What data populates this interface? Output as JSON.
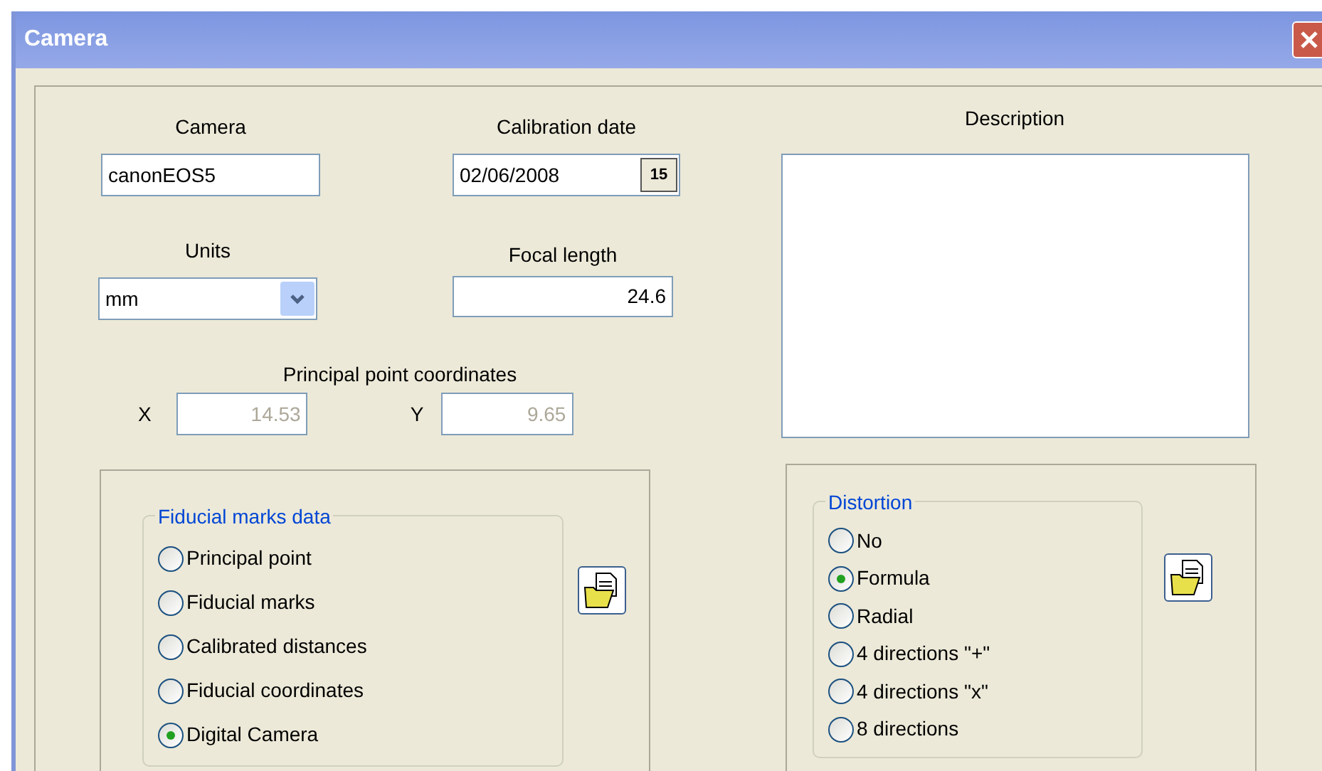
{
  "window": {
    "title": "Camera"
  },
  "camera": {
    "label": "Camera",
    "value": "canonEOS5"
  },
  "calibration_date": {
    "label": "Calibration date",
    "value": "02/06/2008",
    "calendar_button": "15"
  },
  "units": {
    "label": "Units",
    "value": "mm"
  },
  "focal_length": {
    "label": "Focal length",
    "value": "24.6"
  },
  "principal_point": {
    "label": "Principal point coordinates",
    "x_label": "X",
    "x_value": "14.53",
    "x_disabled": true,
    "y_label": "Y",
    "y_value": "9.65",
    "y_disabled": true
  },
  "description": {
    "label": "Description"
  },
  "fiducial_marks": {
    "title": "Fiducial marks data",
    "options": [
      {
        "label": "Principal point",
        "selected": false
      },
      {
        "label": "Fiducial marks",
        "selected": false
      },
      {
        "label": "Calibrated distances",
        "selected": false
      },
      {
        "label": "Fiducial coordinates",
        "selected": false
      },
      {
        "label": "Digital Camera",
        "selected": true
      }
    ]
  },
  "distortion": {
    "title": "Distortion",
    "options": [
      {
        "label": "No",
        "selected": false
      },
      {
        "label": "Formula",
        "selected": true
      },
      {
        "label": "Radial",
        "selected": false
      },
      {
        "label": "4 directions \"+\"",
        "selected": false
      },
      {
        "label": "4 directions \"x\"",
        "selected": false
      },
      {
        "label": "8 directions",
        "selected": false
      }
    ]
  }
}
